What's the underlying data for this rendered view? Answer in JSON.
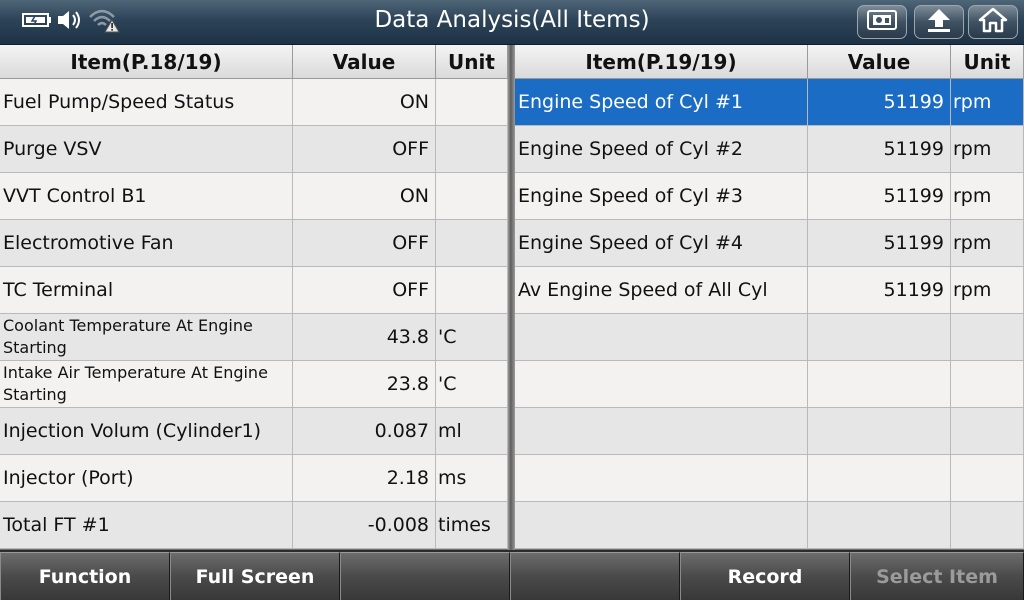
{
  "header": {
    "title": "Data Analysis(All Items)",
    "status_icons": [
      "battery-icon",
      "speaker-icon",
      "wifi-warning-icon"
    ],
    "buttons": [
      "screenshot-icon",
      "upload-icon",
      "home-icon"
    ]
  },
  "left_table": {
    "headers": {
      "item": "Item(P.18/19)",
      "value": "Value",
      "unit": "Unit"
    },
    "rows": [
      {
        "item": "Fuel Pump/Speed Status",
        "value": "ON",
        "unit": ""
      },
      {
        "item": "Purge VSV",
        "value": "OFF",
        "unit": ""
      },
      {
        "item": "VVT Control B1",
        "value": "ON",
        "unit": ""
      },
      {
        "item": "Electromotive Fan",
        "value": "OFF",
        "unit": ""
      },
      {
        "item": "TC Terminal",
        "value": "OFF",
        "unit": ""
      },
      {
        "item": "Coolant Temperature At Engine Starting",
        "value": "43.8",
        "unit": "'C"
      },
      {
        "item": "Intake Air Temperature At Engine Starting",
        "value": "23.8",
        "unit": "'C"
      },
      {
        "item": "Injection Volum (Cylinder1)",
        "value": "0.087",
        "unit": "ml"
      },
      {
        "item": "Injector (Port)",
        "value": "2.18",
        "unit": "ms"
      },
      {
        "item": "Total FT #1",
        "value": "-0.008",
        "unit": "times"
      }
    ]
  },
  "right_table": {
    "headers": {
      "item": "Item(P.19/19)",
      "value": "Value",
      "unit": "Unit"
    },
    "rows": [
      {
        "item": "Engine Speed of Cyl #1",
        "value": "51199",
        "unit": "rpm"
      },
      {
        "item": "Engine Speed of Cyl #2",
        "value": "51199",
        "unit": "rpm"
      },
      {
        "item": "Engine Speed of Cyl #3",
        "value": "51199",
        "unit": "rpm"
      },
      {
        "item": "Engine Speed of Cyl #4",
        "value": "51199",
        "unit": "rpm"
      },
      {
        "item": "Av Engine Speed of All Cyl",
        "value": "51199",
        "unit": "rpm"
      },
      {
        "item": "",
        "value": "",
        "unit": ""
      },
      {
        "item": "",
        "value": "",
        "unit": ""
      },
      {
        "item": "",
        "value": "",
        "unit": ""
      },
      {
        "item": "",
        "value": "",
        "unit": ""
      },
      {
        "item": "",
        "value": "",
        "unit": ""
      }
    ],
    "selected_row": "Engine Speed of Cyl #1"
  },
  "toolbar": {
    "function": "Function",
    "full_screen": "Full Screen",
    "empty1": "",
    "empty2": "",
    "record": "Record",
    "select_item": "Select Item"
  },
  "colors": {
    "selection": "#1a6cc4",
    "title_bar": "#2d4357"
  }
}
